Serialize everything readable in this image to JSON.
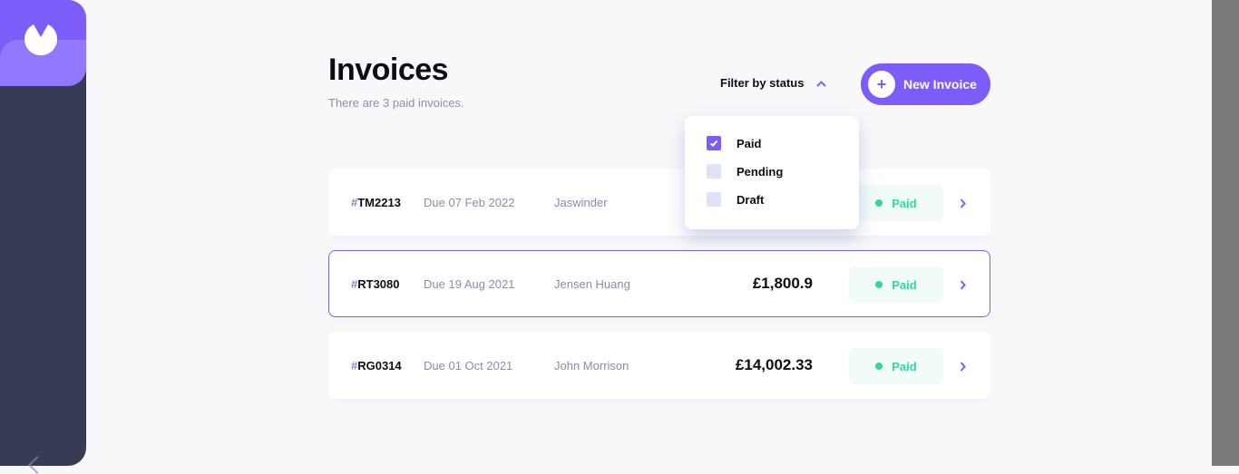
{
  "header": {
    "title": "Invoices",
    "subtitle": "There are 3 paid invoices.",
    "filter_label": "Filter by status",
    "new_invoice_label": "New Invoice"
  },
  "filter_menu": {
    "options": [
      {
        "label": "Paid",
        "checked": true
      },
      {
        "label": "Pending",
        "checked": false
      },
      {
        "label": "Draft",
        "checked": false
      }
    ]
  },
  "invoices": [
    {
      "hash": "#",
      "id": "TM2213",
      "due": "Due 07 Feb 2022",
      "client": "Jaswinder",
      "amount": "",
      "status": "Paid"
    },
    {
      "hash": "#",
      "id": "RT3080",
      "due": "Due 19 Aug 2021",
      "client": "Jensen Huang",
      "amount": "£1,800.9",
      "status": "Paid"
    },
    {
      "hash": "#",
      "id": "RG0314",
      "due": "Due 01 Oct 2021",
      "client": "John Morrison",
      "amount": "£14,002.33",
      "status": "Paid"
    }
  ],
  "colors": {
    "accent": "#7c5dfa",
    "sidebar": "#373b53",
    "paid": "#33d69f",
    "background": "#f8f8fb"
  },
  "icons": {
    "logo": "logo-icon",
    "filter_chevron": "chevron-up-icon",
    "new_invoice": "plus-icon",
    "row_arrow": "chevron-right-icon",
    "check": "check-icon"
  }
}
